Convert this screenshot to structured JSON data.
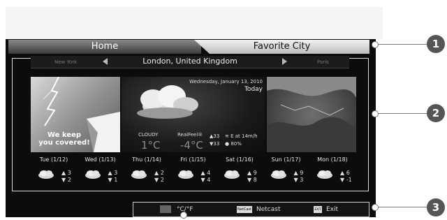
{
  "tabs": {
    "home": "Home",
    "favorite": "Favorite City"
  },
  "city_bar": {
    "prev": "New York",
    "current": "London, United Kingdom",
    "next": "Paris"
  },
  "promo": {
    "line1": "We keep",
    "line2": "you covered!"
  },
  "today": {
    "date": "Wednesday, January 13, 2010",
    "label": "Today",
    "condition": "CLOUDY",
    "temp": "1°C",
    "realfeel_label": "RealFeel®",
    "realfeel_temp": "-4°C",
    "high": "33",
    "low": "33",
    "wind": "E at 14m/h",
    "humidity": "80%"
  },
  "forecast": [
    {
      "day": "Tue (1/12)",
      "hi": "3",
      "lo": "2"
    },
    {
      "day": "Wed (1/13)",
      "hi": "3",
      "lo": "1"
    },
    {
      "day": "Thu (1/14)",
      "hi": "2",
      "lo": "2"
    },
    {
      "day": "Fri (1/15)",
      "hi": "4",
      "lo": "4"
    },
    {
      "day": "Sat (1/16)",
      "hi": "9",
      "lo": "8"
    },
    {
      "day": "Sun (1/17)",
      "hi": "9",
      "lo": "3"
    },
    {
      "day": "Mon (1/18)",
      "hi": "6",
      "lo": "-1"
    }
  ],
  "bottom": {
    "unit": "°C/°F",
    "netcast_logo": "NetCast",
    "netcast": "Netcast",
    "exit_key": "EXIT",
    "exit": "Exit"
  },
  "callouts": [
    "1",
    "2",
    "3"
  ],
  "icons": {
    "up": "▲",
    "down": "▼",
    "prev_arrow": "left-arrow-icon",
    "next_arrow": "right-arrow-icon"
  }
}
